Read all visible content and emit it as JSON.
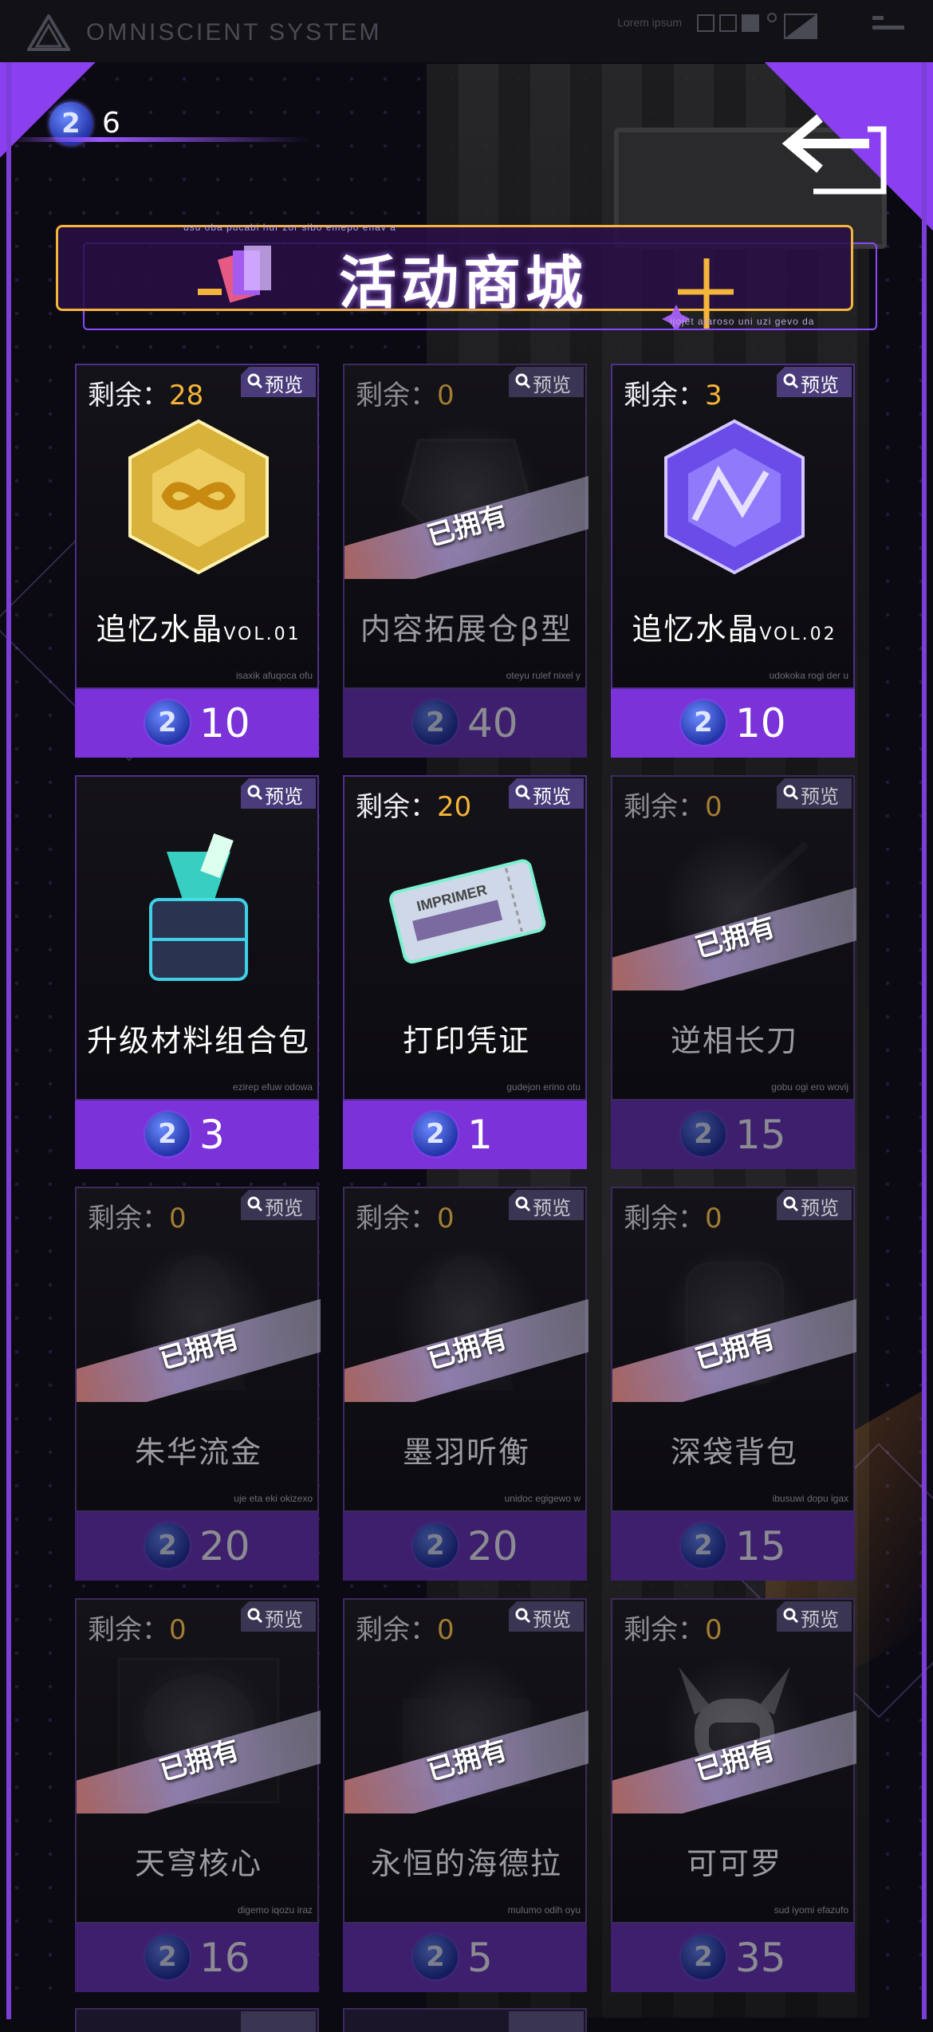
{
  "system_bar": {
    "title": "OMNISCIENT SYSTEM",
    "lorem": "Lorem ipsum"
  },
  "currency": {
    "icon": "ticket-coin-icon",
    "amount": "6"
  },
  "header": {
    "title": "活动商城",
    "tiny_top": "usu oba pucabi hur zor sibo emepo enav a",
    "tiny_bottom": "ijojet alaroso uni uzi gevo da"
  },
  "labels": {
    "stock_prefix": "剩余：",
    "preview": "预览",
    "owned": "已拥有"
  },
  "items": [
    {
      "name": "追忆水晶",
      "vol": "VOL.01",
      "stock": "28",
      "price": "10",
      "owned": false,
      "tiny": "isaxik afuqoca ofu",
      "art": "gold-crystal-icon"
    },
    {
      "name": "内容拓展仓β型",
      "vol": "",
      "stock": "0",
      "price": "40",
      "owned": true,
      "tiny": "oteyu rulef nixel y",
      "art": "expansion-module-icon"
    },
    {
      "name": "追忆水晶",
      "vol": "VOL.02",
      "stock": "3",
      "price": "10",
      "owned": false,
      "tiny": "udokoka rogi der u",
      "art": "purple-crystal-icon"
    },
    {
      "name": "升级材料组合包",
      "vol": "",
      "stock": "",
      "price": "3",
      "owned": false,
      "tiny": "ezirep efuw odowa",
      "art": "material-box-icon"
    },
    {
      "name": "打印凭证",
      "vol": "",
      "stock": "20",
      "price": "1",
      "owned": false,
      "tiny": "gudejon erino otu",
      "art": "print-ticket-icon"
    },
    {
      "name": "逆相长刀",
      "vol": "",
      "stock": "0",
      "price": "15",
      "owned": true,
      "tiny": "gobu ogi ero wovij",
      "art": "blade-icon"
    },
    {
      "name": "朱华流金",
      "vol": "",
      "stock": "0",
      "price": "20",
      "owned": true,
      "tiny": "uje eta eki okizexo",
      "art": "outfit-icon"
    },
    {
      "name": "墨羽听衡",
      "vol": "",
      "stock": "0",
      "price": "20",
      "owned": true,
      "tiny": "unidoc egigewo w",
      "art": "outfit-icon"
    },
    {
      "name": "深袋背包",
      "vol": "",
      "stock": "0",
      "price": "15",
      "owned": true,
      "tiny": "ibusuwi dopu igax",
      "art": "backpack-icon"
    },
    {
      "name": "天穹核心",
      "vol": "",
      "stock": "0",
      "price": "16",
      "owned": true,
      "tiny": "digemo iqozu iraz",
      "art": "core-icon"
    },
    {
      "name": "永恒的海德拉",
      "vol": "",
      "stock": "0",
      "price": "5",
      "owned": true,
      "tiny": "mulumo odih oyu",
      "art": "hydra-icon"
    },
    {
      "name": "可可罗",
      "vol": "",
      "stock": "0",
      "price": "35",
      "owned": true,
      "tiny": "sud iyomi efazufo",
      "art": "robot-pet-icon"
    }
  ],
  "colors": {
    "accent_purple": "#7b32d8",
    "owned_purple": "#3d1f6e",
    "gold": "#f5b43a",
    "frame_purple": "#8a3ff0"
  }
}
